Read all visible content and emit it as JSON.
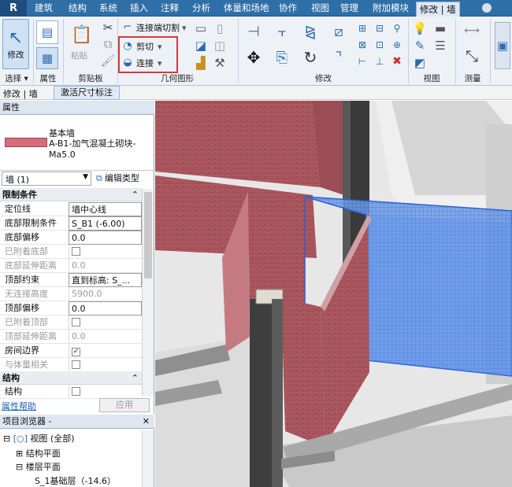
{
  "menubar": {
    "logo": "R",
    "tabs": [
      "建筑",
      "结构",
      "系统",
      "插入",
      "注释",
      "分析",
      "体量和场地",
      "协作",
      "视图",
      "管理",
      "附加模块",
      "修改 | 墙"
    ],
    "active_tab": "修改 | 墙"
  },
  "ribbon": {
    "select_group": {
      "modify_label": "修改",
      "group_label": "选择 ▾"
    },
    "properties_group": {
      "group_label": "属性"
    },
    "clipboard_group": {
      "paste_label": "粘贴",
      "group_label": "剪贴板"
    },
    "geometry_group": {
      "join_end_cut": "连接端切割",
      "cut": "剪切",
      "join": "连接",
      "group_label": "几何图形"
    },
    "modify_group": {
      "group_label": "修改"
    },
    "view_group": {
      "group_label": "视图"
    },
    "measure_group": {
      "group_label": "测量"
    }
  },
  "context_bar": {
    "label": "修改 | 墙",
    "tab": "激活尺寸标注"
  },
  "properties": {
    "title": "属性",
    "type_family": "基本墙",
    "type_name": "A-B1-加气混凝土砌块-Ma5.0",
    "instance_filter": "墙 (1)",
    "edit_type": "编辑类型",
    "sections": {
      "constraints": "限制条件",
      "structure": "结构"
    },
    "rows": [
      {
        "k": "定位线",
        "v": "墙中心线",
        "grey": false
      },
      {
        "k": "底部限制条件",
        "v": "S_B1 (-6.00)",
        "grey": false
      },
      {
        "k": "底部偏移",
        "v": "0.0",
        "grey": false
      },
      {
        "k": "已附着底部",
        "v": "",
        "grey": true
      },
      {
        "k": "底部延伸距离",
        "v": "0.0",
        "grey": true
      },
      {
        "k": "顶部约束",
        "v": "直到标高: S_...",
        "grey": false
      },
      {
        "k": "无连接高度",
        "v": "5900.0",
        "grey": true
      },
      {
        "k": "顶部偏移",
        "v": "0.0",
        "grey": false
      },
      {
        "k": "已附着顶部",
        "v": "",
        "grey": true
      },
      {
        "k": "顶部延伸距离",
        "v": "0.0",
        "grey": true
      },
      {
        "k": "房间边界",
        "v": "✓",
        "grey": false
      },
      {
        "k": "与体量相关",
        "v": "",
        "grey": true
      }
    ],
    "structure_row": "结构",
    "help_link": "属性帮助",
    "apply": "应用"
  },
  "browser": {
    "title": "项目浏览器 -",
    "items": [
      "视图 (全部)",
      "结构平面",
      "楼层平面",
      "S_1基础层（-14.6）"
    ]
  },
  "colors": {
    "wall": "#b96b72",
    "selection": "#3f78d8",
    "ribbon": "#eef2f7",
    "menubar": "#2f6fa8"
  }
}
